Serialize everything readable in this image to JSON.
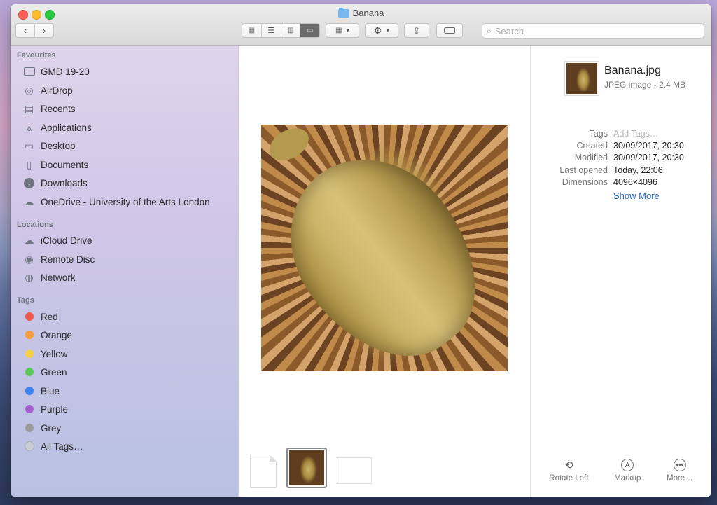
{
  "window": {
    "title": "Banana"
  },
  "toolbar": {
    "search_placeholder": "Search"
  },
  "sidebar": {
    "favourites_heading": "Favourites",
    "favourites": [
      {
        "label": "GMD 19-20",
        "icon": "folder-icon"
      },
      {
        "label": "AirDrop",
        "icon": "airdrop-icon"
      },
      {
        "label": "Recents",
        "icon": "recents-icon"
      },
      {
        "label": "Applications",
        "icon": "applications-icon"
      },
      {
        "label": "Desktop",
        "icon": "desktop-icon"
      },
      {
        "label": "Documents",
        "icon": "documents-icon"
      },
      {
        "label": "Downloads",
        "icon": "downloads-icon"
      },
      {
        "label": "OneDrive - University of the Arts London",
        "icon": "cloud-icon"
      }
    ],
    "locations_heading": "Locations",
    "locations": [
      {
        "label": "iCloud Drive",
        "icon": "cloud-icon"
      },
      {
        "label": "Remote Disc",
        "icon": "disc-icon"
      },
      {
        "label": "Network",
        "icon": "globe-icon"
      }
    ],
    "tags_heading": "Tags",
    "tags": [
      {
        "label": "Red",
        "color": "#ef5a50"
      },
      {
        "label": "Orange",
        "color": "#f59d3a"
      },
      {
        "label": "Yellow",
        "color": "#f5cf45"
      },
      {
        "label": "Green",
        "color": "#5ec75a"
      },
      {
        "label": "Blue",
        "color": "#3b82f0"
      },
      {
        "label": "Purple",
        "color": "#a55fd0"
      },
      {
        "label": "Grey",
        "color": "#9a9a9a"
      },
      {
        "label": "All Tags…",
        "color": "#c9cdd6"
      }
    ]
  },
  "info": {
    "file_name": "Banana.jpg",
    "file_kind": "JPEG image - 2.4 MB",
    "tags_label": "Tags",
    "tags_placeholder": "Add Tags…",
    "created_label": "Created",
    "created_value": "30/09/2017, 20:30",
    "modified_label": "Modified",
    "modified_value": "30/09/2017, 20:30",
    "last_opened_label": "Last opened",
    "last_opened_value": "Today, 22:06",
    "dimensions_label": "Dimensions",
    "dimensions_value": "4096×4096",
    "show_more": "Show More"
  },
  "actions": {
    "rotate_left": "Rotate Left",
    "markup": "Markup",
    "more": "More…"
  }
}
